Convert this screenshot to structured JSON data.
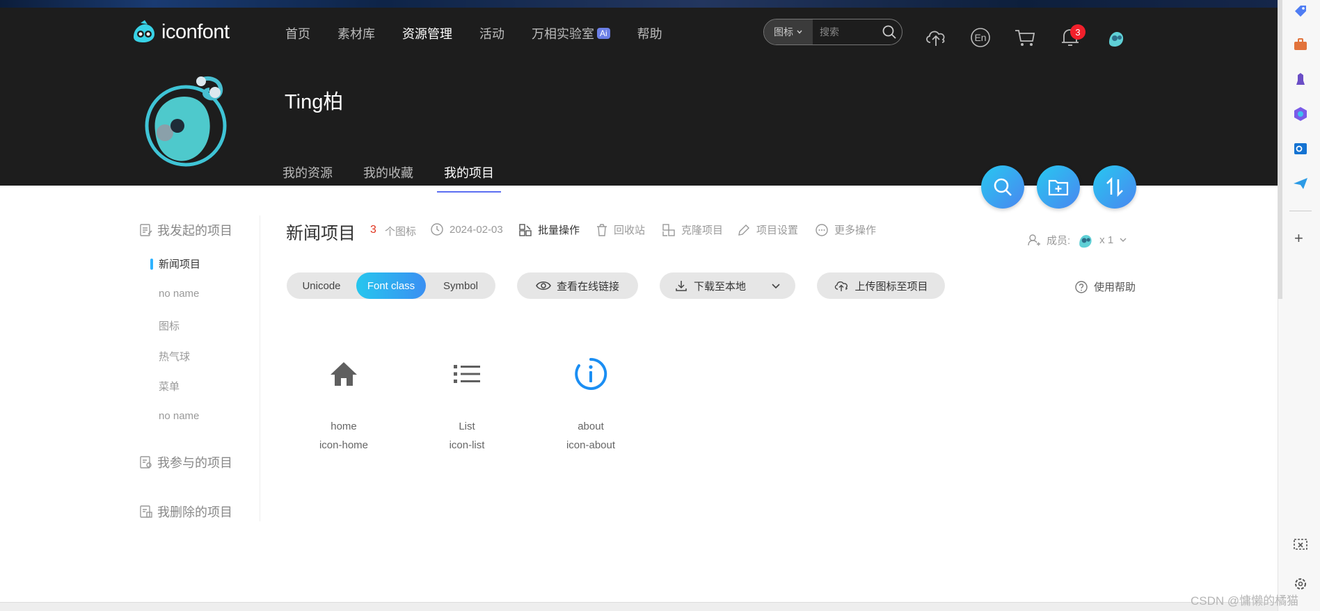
{
  "header": {
    "logo_text": "iconfont",
    "nav": [
      {
        "label": "首页"
      },
      {
        "label": "素材库"
      },
      {
        "label": "资源管理"
      },
      {
        "label": "活动"
      },
      {
        "label": "万相实验室",
        "badge": "Ai"
      },
      {
        "label": "帮助"
      }
    ],
    "search": {
      "type": "图标",
      "placeholder": "搜索"
    },
    "lang_label": "En",
    "notification_count": "3"
  },
  "profile": {
    "name": "Ting柏",
    "tabs": [
      "我的资源",
      "我的收藏",
      "我的项目"
    ]
  },
  "sidebar": {
    "groups": [
      {
        "label": "我发起的项目",
        "items": [
          "新闻项目",
          "no name",
          "图标",
          "热气球",
          "菜单",
          "no name"
        ]
      },
      {
        "label": "我参与的项目"
      },
      {
        "label": "我删除的项目"
      }
    ]
  },
  "project": {
    "title": "新闻项目",
    "icon_count": "3",
    "icon_count_label": "个图标",
    "date": "2024-02-03",
    "actions": [
      "批量操作",
      "回收站",
      "克隆项目",
      "项目设置",
      "更多操作"
    ],
    "members_label": "成员:",
    "members_count": "x 1"
  },
  "toolbar": {
    "tabs": [
      "Unicode",
      "Font class",
      "Symbol"
    ],
    "view_link": "查看在线链接",
    "download": "下载至本地",
    "upload": "上传图标至项目",
    "help": "使用帮助"
  },
  "icons": [
    {
      "name": "home",
      "class": "icon-home",
      "icon": "home-icon",
      "color": "#5f5f5f"
    },
    {
      "name": "List",
      "class": "icon-list",
      "icon": "list-icon",
      "color": "#5f5f5f"
    },
    {
      "name": "about",
      "class": "icon-about",
      "icon": "info-icon",
      "color": "#1b8ef3"
    }
  ],
  "colors": {
    "header_bg": "#1d1d1d",
    "accent_gradient_start": "#26c6ee",
    "accent_gradient_end": "#3a8ff2",
    "badge_red": "#f2202b"
  },
  "watermark": "CSDN @慵懒的橘猫"
}
